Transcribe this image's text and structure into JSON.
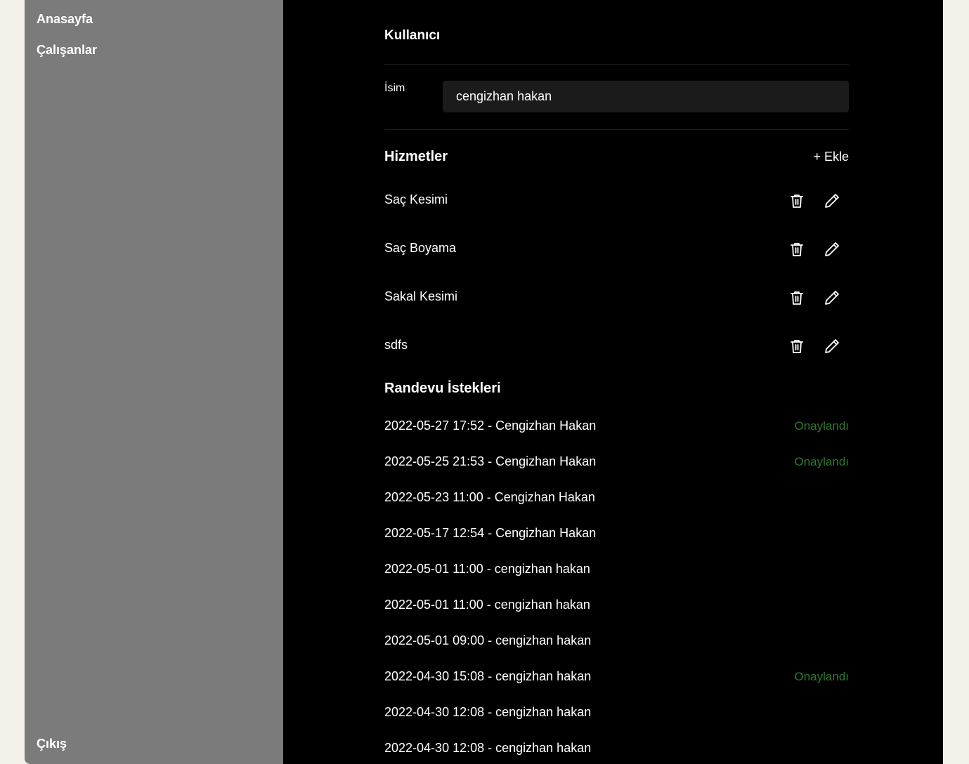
{
  "sidebar": {
    "items": [
      {
        "label": "Anasayfa"
      },
      {
        "label": "Çalışanlar"
      }
    ],
    "logout_label": "Çıkış"
  },
  "user_section": {
    "title": "Kullanıcı",
    "name_label": "İsim",
    "name_value": "cengizhan hakan"
  },
  "services": {
    "title": "Hizmetler",
    "add_label": "+ Ekle",
    "items": [
      {
        "name": "Saç Kesimi"
      },
      {
        "name": "Saç Boyama"
      },
      {
        "name": "Sakal Kesimi"
      },
      {
        "name": "sdfs"
      }
    ]
  },
  "appointments": {
    "title": "Randevu İstekleri",
    "items": [
      {
        "text": "2022-05-27 17:52 - Cengizhan Hakan",
        "status": "Onaylandı"
      },
      {
        "text": "2022-05-25 21:53 - Cengizhan Hakan",
        "status": "Onaylandı"
      },
      {
        "text": "2022-05-23 11:00 - Cengizhan Hakan",
        "status": ""
      },
      {
        "text": "2022-05-17 12:54 - Cengizhan Hakan",
        "status": ""
      },
      {
        "text": "2022-05-01 11:00 - cengizhan hakan",
        "status": ""
      },
      {
        "text": "2022-05-01 11:00 - cengizhan hakan",
        "status": ""
      },
      {
        "text": "2022-05-01 09:00 - cengizhan hakan",
        "status": ""
      },
      {
        "text": "2022-04-30 15:08 - cengizhan hakan",
        "status": "Onaylandı"
      },
      {
        "text": "2022-04-30 12:08 - cengizhan hakan",
        "status": ""
      },
      {
        "text": "2022-04-30 12:08 - cengizhan hakan",
        "status": ""
      }
    ]
  },
  "colors": {
    "sidebar_bg": "#7b7b7b",
    "main_bg": "#000000",
    "page_bg": "#f3f0e9",
    "approved_status": "#2d7a2d"
  }
}
